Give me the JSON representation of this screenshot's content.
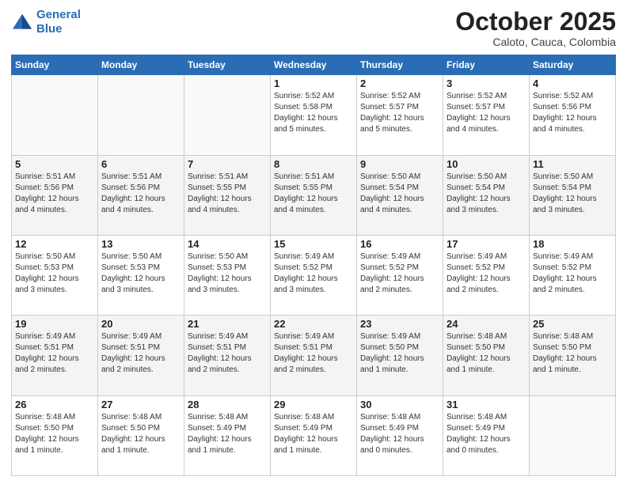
{
  "header": {
    "logo_line1": "General",
    "logo_line2": "Blue",
    "month": "October 2025",
    "location": "Caloto, Cauca, Colombia"
  },
  "days_of_week": [
    "Sunday",
    "Monday",
    "Tuesday",
    "Wednesday",
    "Thursday",
    "Friday",
    "Saturday"
  ],
  "weeks": [
    [
      {
        "day": "",
        "text": ""
      },
      {
        "day": "",
        "text": ""
      },
      {
        "day": "",
        "text": ""
      },
      {
        "day": "1",
        "text": "Sunrise: 5:52 AM\nSunset: 5:58 PM\nDaylight: 12 hours\nand 5 minutes."
      },
      {
        "day": "2",
        "text": "Sunrise: 5:52 AM\nSunset: 5:57 PM\nDaylight: 12 hours\nand 5 minutes."
      },
      {
        "day": "3",
        "text": "Sunrise: 5:52 AM\nSunset: 5:57 PM\nDaylight: 12 hours\nand 4 minutes."
      },
      {
        "day": "4",
        "text": "Sunrise: 5:52 AM\nSunset: 5:56 PM\nDaylight: 12 hours\nand 4 minutes."
      }
    ],
    [
      {
        "day": "5",
        "text": "Sunrise: 5:51 AM\nSunset: 5:56 PM\nDaylight: 12 hours\nand 4 minutes."
      },
      {
        "day": "6",
        "text": "Sunrise: 5:51 AM\nSunset: 5:56 PM\nDaylight: 12 hours\nand 4 minutes."
      },
      {
        "day": "7",
        "text": "Sunrise: 5:51 AM\nSunset: 5:55 PM\nDaylight: 12 hours\nand 4 minutes."
      },
      {
        "day": "8",
        "text": "Sunrise: 5:51 AM\nSunset: 5:55 PM\nDaylight: 12 hours\nand 4 minutes."
      },
      {
        "day": "9",
        "text": "Sunrise: 5:50 AM\nSunset: 5:54 PM\nDaylight: 12 hours\nand 4 minutes."
      },
      {
        "day": "10",
        "text": "Sunrise: 5:50 AM\nSunset: 5:54 PM\nDaylight: 12 hours\nand 3 minutes."
      },
      {
        "day": "11",
        "text": "Sunrise: 5:50 AM\nSunset: 5:54 PM\nDaylight: 12 hours\nand 3 minutes."
      }
    ],
    [
      {
        "day": "12",
        "text": "Sunrise: 5:50 AM\nSunset: 5:53 PM\nDaylight: 12 hours\nand 3 minutes."
      },
      {
        "day": "13",
        "text": "Sunrise: 5:50 AM\nSunset: 5:53 PM\nDaylight: 12 hours\nand 3 minutes."
      },
      {
        "day": "14",
        "text": "Sunrise: 5:50 AM\nSunset: 5:53 PM\nDaylight: 12 hours\nand 3 minutes."
      },
      {
        "day": "15",
        "text": "Sunrise: 5:49 AM\nSunset: 5:52 PM\nDaylight: 12 hours\nand 3 minutes."
      },
      {
        "day": "16",
        "text": "Sunrise: 5:49 AM\nSunset: 5:52 PM\nDaylight: 12 hours\nand 2 minutes."
      },
      {
        "day": "17",
        "text": "Sunrise: 5:49 AM\nSunset: 5:52 PM\nDaylight: 12 hours\nand 2 minutes."
      },
      {
        "day": "18",
        "text": "Sunrise: 5:49 AM\nSunset: 5:52 PM\nDaylight: 12 hours\nand 2 minutes."
      }
    ],
    [
      {
        "day": "19",
        "text": "Sunrise: 5:49 AM\nSunset: 5:51 PM\nDaylight: 12 hours\nand 2 minutes."
      },
      {
        "day": "20",
        "text": "Sunrise: 5:49 AM\nSunset: 5:51 PM\nDaylight: 12 hours\nand 2 minutes."
      },
      {
        "day": "21",
        "text": "Sunrise: 5:49 AM\nSunset: 5:51 PM\nDaylight: 12 hours\nand 2 minutes."
      },
      {
        "day": "22",
        "text": "Sunrise: 5:49 AM\nSunset: 5:51 PM\nDaylight: 12 hours\nand 2 minutes."
      },
      {
        "day": "23",
        "text": "Sunrise: 5:49 AM\nSunset: 5:50 PM\nDaylight: 12 hours\nand 1 minute."
      },
      {
        "day": "24",
        "text": "Sunrise: 5:48 AM\nSunset: 5:50 PM\nDaylight: 12 hours\nand 1 minute."
      },
      {
        "day": "25",
        "text": "Sunrise: 5:48 AM\nSunset: 5:50 PM\nDaylight: 12 hours\nand 1 minute."
      }
    ],
    [
      {
        "day": "26",
        "text": "Sunrise: 5:48 AM\nSunset: 5:50 PM\nDaylight: 12 hours\nand 1 minute."
      },
      {
        "day": "27",
        "text": "Sunrise: 5:48 AM\nSunset: 5:50 PM\nDaylight: 12 hours\nand 1 minute."
      },
      {
        "day": "28",
        "text": "Sunrise: 5:48 AM\nSunset: 5:49 PM\nDaylight: 12 hours\nand 1 minute."
      },
      {
        "day": "29",
        "text": "Sunrise: 5:48 AM\nSunset: 5:49 PM\nDaylight: 12 hours\nand 1 minute."
      },
      {
        "day": "30",
        "text": "Sunrise: 5:48 AM\nSunset: 5:49 PM\nDaylight: 12 hours\nand 0 minutes."
      },
      {
        "day": "31",
        "text": "Sunrise: 5:48 AM\nSunset: 5:49 PM\nDaylight: 12 hours\nand 0 minutes."
      },
      {
        "day": "",
        "text": ""
      }
    ]
  ]
}
